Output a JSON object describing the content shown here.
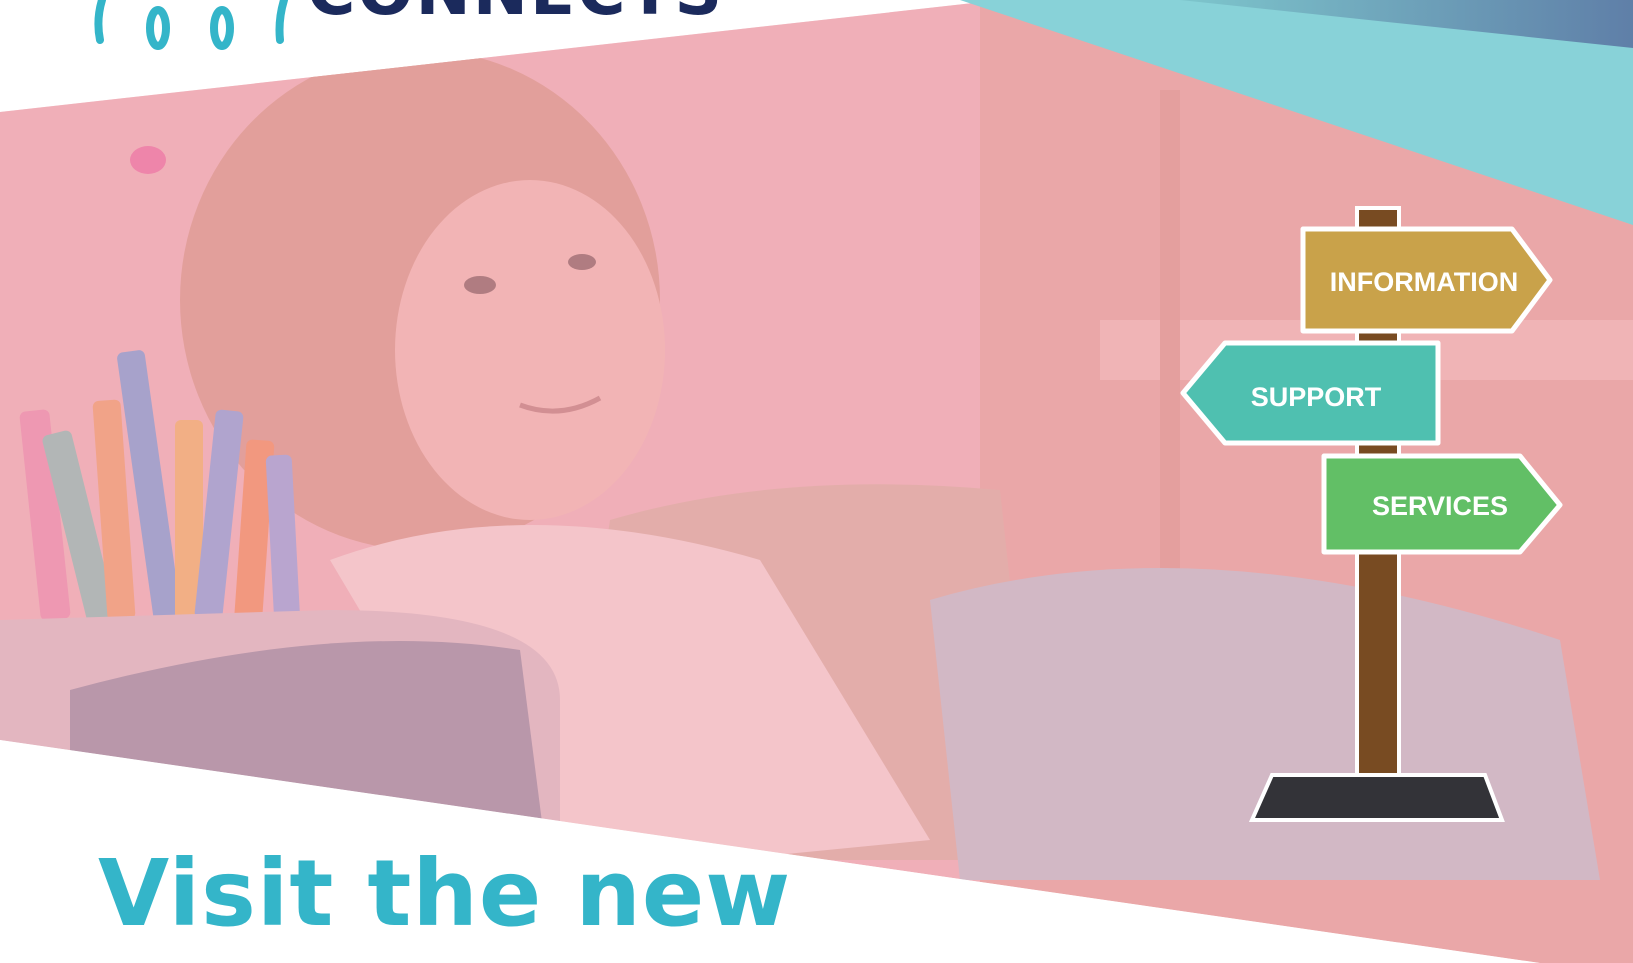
{
  "logo": {
    "wordmark": "CONNECTS",
    "colors": {
      "figures": "#34b5c9",
      "wordmark": "#1b2a5c"
    }
  },
  "signpost": {
    "signs": [
      {
        "label": "INFORMATION",
        "color": "#c9a24a",
        "direction": "right"
      },
      {
        "label": "SUPPORT",
        "color": "#4fc0b0",
        "direction": "left"
      },
      {
        "label": "SERVICES",
        "color": "#62bf66",
        "direction": "right"
      }
    ],
    "post_color": "#784b22",
    "base_color": "#333338"
  },
  "photo": {
    "subject": "girl-with-colored-markers",
    "overlay_color": "#f2a7b4"
  },
  "headline": {
    "text": "Visit the new"
  },
  "colors": {
    "accent_teal": "#34b5c9",
    "banner_teal": "#88d2d8",
    "navy": "#1b2a5c"
  }
}
